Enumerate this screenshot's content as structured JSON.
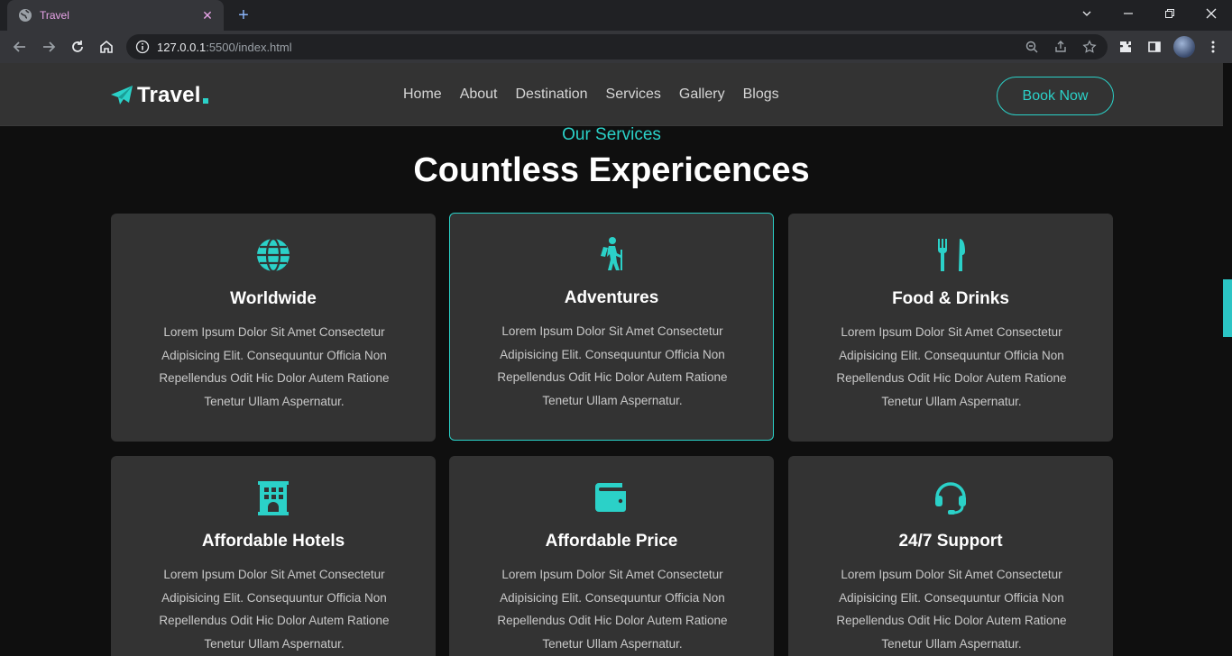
{
  "browser": {
    "tab_title": "Travel",
    "new_tab": "+",
    "url_host": "127.0.0.1",
    "url_rest": ":5500/index.html"
  },
  "colors": {
    "accent": "#2bd1c8",
    "card": "#333333",
    "bg": "#0f0f0f"
  },
  "header": {
    "logo": "Travel",
    "nav": [
      "Home",
      "About",
      "Destination",
      "Services",
      "Gallery",
      "Blogs"
    ],
    "cta": "Book Now"
  },
  "section": {
    "subtitle": "Our Services",
    "title": "Countless Expericences"
  },
  "cards": [
    {
      "icon": "globe-icon",
      "title": "Worldwide",
      "text": "Lorem Ipsum Dolor Sit Amet Consectetur Adipisicing Elit. Consequuntur Officia Non Repellendus Odit Hic Dolor Autem Ratione Tenetur Ullam Aspernatur."
    },
    {
      "icon": "hiking-icon",
      "title": "Adventures",
      "text": "Lorem Ipsum Dolor Sit Amet Consectetur Adipisicing Elit. Consequuntur Officia Non Repellendus Odit Hic Dolor Autem Ratione Tenetur Ullam Aspernatur."
    },
    {
      "icon": "utensils-icon",
      "title": "Food & Drinks",
      "text": "Lorem Ipsum Dolor Sit Amet Consectetur Adipisicing Elit. Consequuntur Officia Non Repellendus Odit Hic Dolor Autem Ratione Tenetur Ullam Aspernatur."
    },
    {
      "icon": "hotel-icon",
      "title": "Affordable Hotels",
      "text": "Lorem Ipsum Dolor Sit Amet Consectetur Adipisicing Elit. Consequuntur Officia Non Repellendus Odit Hic Dolor Autem Ratione Tenetur Ullam Aspernatur."
    },
    {
      "icon": "wallet-icon",
      "title": "Affordable Price",
      "text": "Lorem Ipsum Dolor Sit Amet Consectetur Adipisicing Elit. Consequuntur Officia Non Repellendus Odit Hic Dolor Autem Ratione Tenetur Ullam Aspernatur."
    },
    {
      "icon": "headset-icon",
      "title": "24/7 Support",
      "text": "Lorem Ipsum Dolor Sit Amet Consectetur Adipisicing Elit. Consequuntur Officia Non Repellendus Odit Hic Dolor Autem Ratione Tenetur Ullam Aspernatur."
    }
  ]
}
